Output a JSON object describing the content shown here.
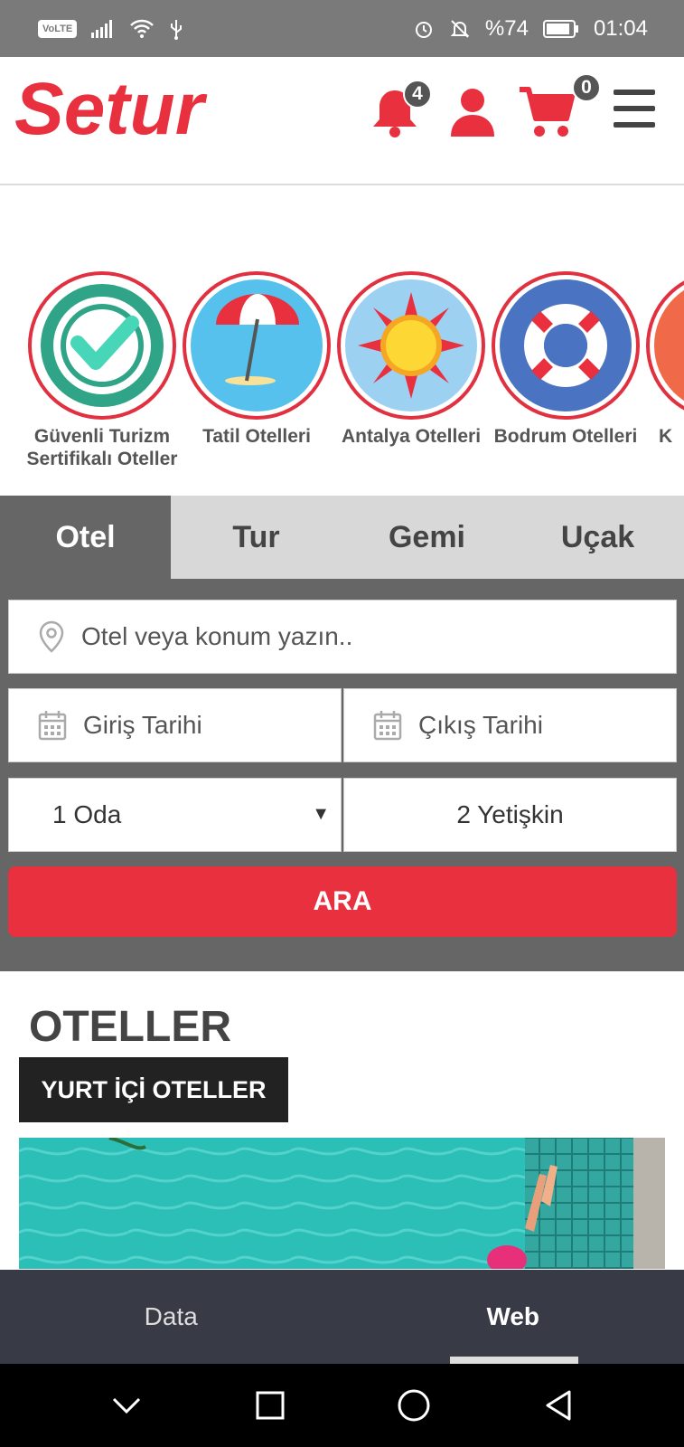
{
  "status_bar": {
    "volte": "VoLTE",
    "battery": "%74",
    "time": "01:04"
  },
  "header": {
    "logo_text": "Setur",
    "notifications_count": "4",
    "cart_count": "0"
  },
  "categories": [
    {
      "label": "Güvenli Turizm Sertifikalı Oteller",
      "icon": "certified-check-icon"
    },
    {
      "label": "Tatil Otelleri",
      "icon": "beach-umbrella-icon"
    },
    {
      "label": "Antalya Otelleri",
      "icon": "sun-icon"
    },
    {
      "label": "Bodrum Otelleri",
      "icon": "lifebuoy-icon"
    },
    {
      "label": "K",
      "icon": "partial-icon"
    }
  ],
  "search": {
    "tabs": [
      "Otel",
      "Tur",
      "Gemi",
      "Uçak"
    ],
    "active_tab": "Otel",
    "location_placeholder": "Otel veya konum yazın..",
    "checkin_placeholder": "Giriş Tarihi",
    "checkout_placeholder": "Çıkış Tarihi",
    "rooms_value": "1 Oda",
    "guests_value": "2 Yetişkin",
    "submit_label": "ARA"
  },
  "hotels": {
    "title": "OTELLER",
    "domestic_button": "YURT İÇİ OTELLER"
  },
  "app_tabs": [
    "Data",
    "Web"
  ],
  "active_app_tab": "Web",
  "colors": {
    "brand_red": "#e8303f",
    "panel_gray": "#666666",
    "tab_gray": "#d8d8d8"
  }
}
